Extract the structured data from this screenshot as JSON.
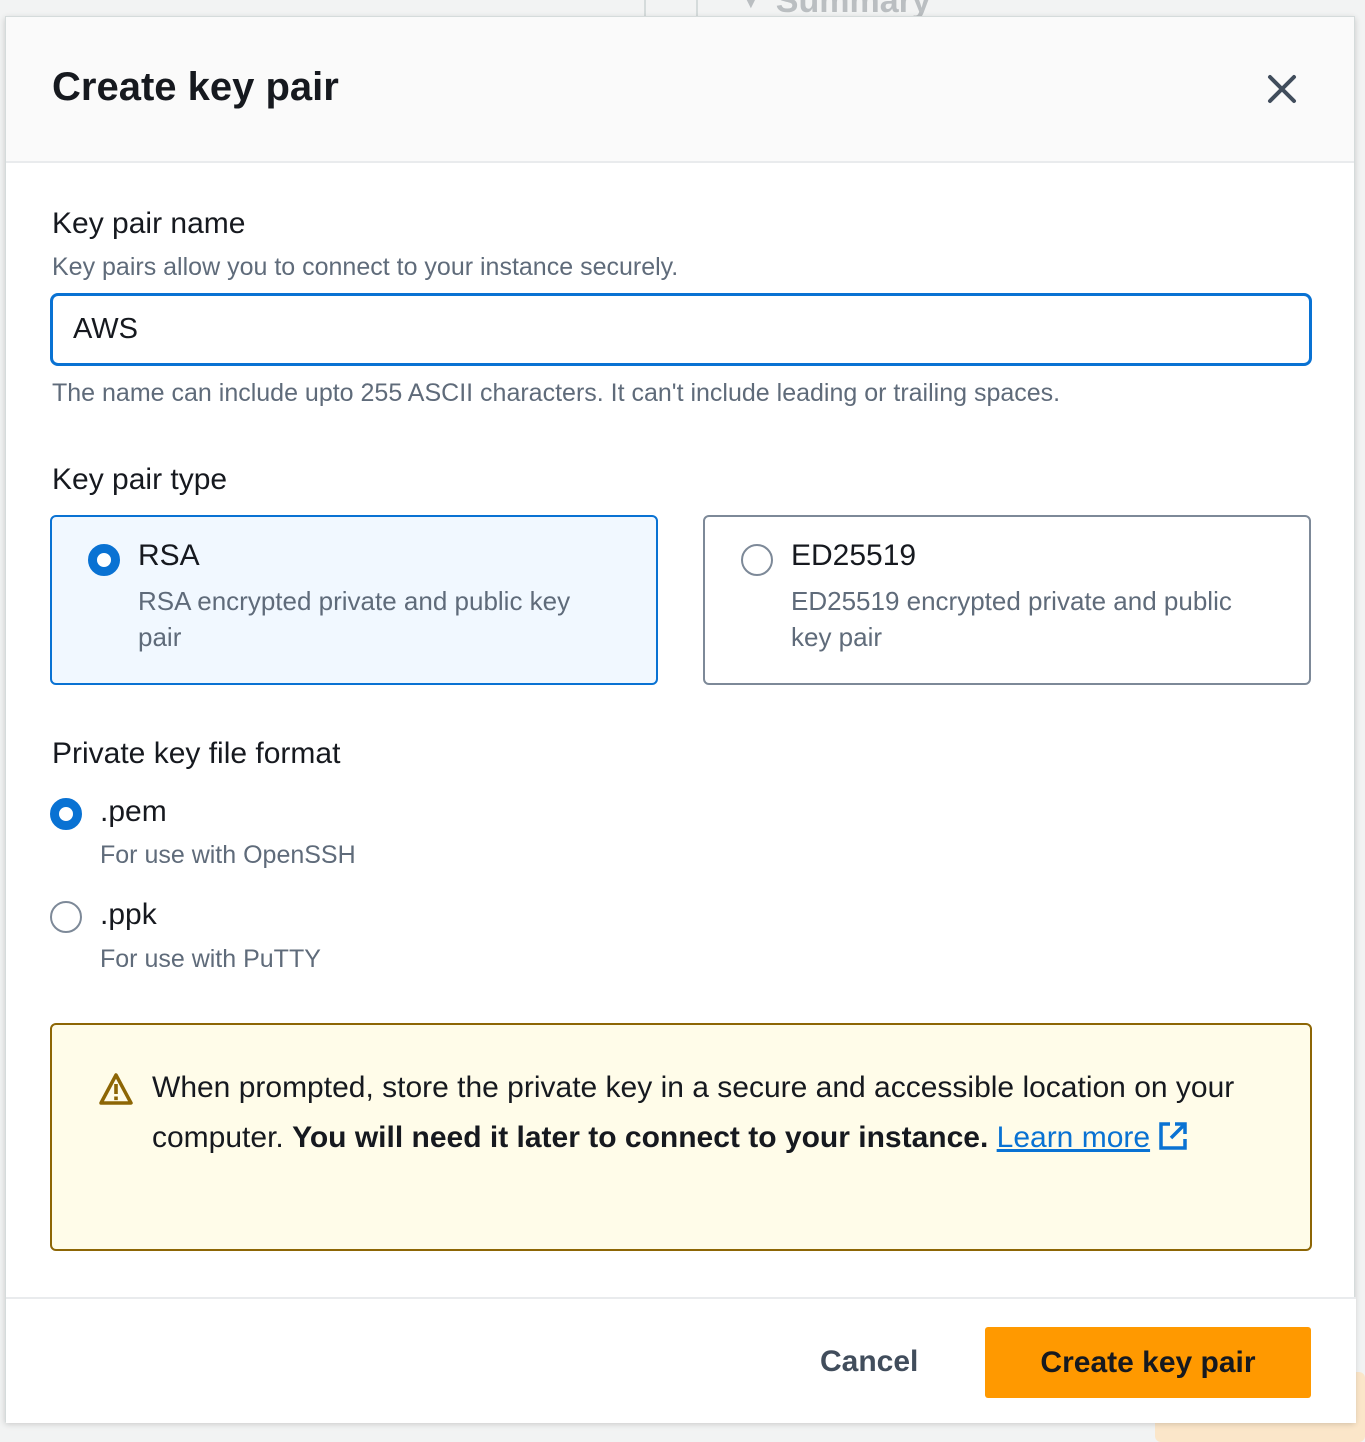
{
  "background": {
    "section_title": "Summary"
  },
  "modal": {
    "title": "Create key pair",
    "close_icon": "close-icon",
    "key_pair_name": {
      "label": "Key pair name",
      "description": "Key pairs allow you to connect to your instance securely.",
      "value": "AWS",
      "constraint": "The name can include upto 255 ASCII characters. It can't include leading or trailing spaces."
    },
    "key_pair_type": {
      "label": "Key pair type",
      "options": [
        {
          "title": "RSA",
          "description": "RSA encrypted private and public key pair",
          "selected": true
        },
        {
          "title": "ED25519",
          "description": "ED25519 encrypted private and public key pair",
          "selected": false
        }
      ]
    },
    "file_format": {
      "label": "Private key file format",
      "options": [
        {
          "title": ".pem",
          "description": "For use with OpenSSH",
          "selected": true
        },
        {
          "title": ".ppk",
          "description": "For use with PuTTY",
          "selected": false
        }
      ]
    },
    "warning": {
      "icon": "warning-icon",
      "text_start": "When prompted, store the private key in a secure and accessible location on your computer. ",
      "text_bold": "You will need it later to connect to your instance.",
      "link_text": "Learn more",
      "link_icon": "external-link-icon"
    },
    "footer": {
      "cancel_label": "Cancel",
      "create_label": "Create key pair"
    }
  },
  "colors": {
    "accent": "#0972d3",
    "primary_button": "#ff9900",
    "warning_border": "#8d6605",
    "warning_bg": "#fffce9"
  }
}
